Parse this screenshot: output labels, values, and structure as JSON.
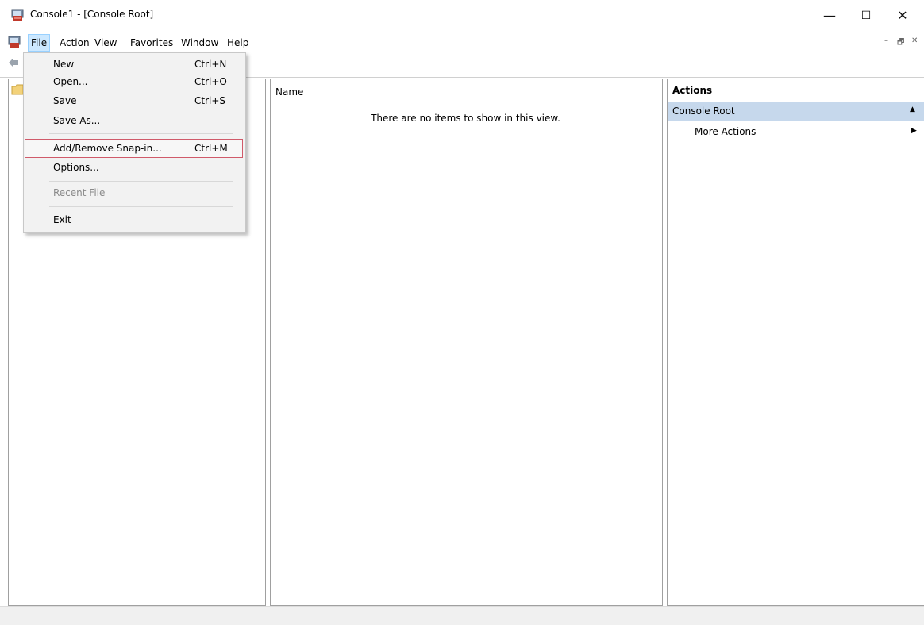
{
  "window": {
    "title": "Console1 - [Console Root]",
    "controls": {
      "minimize": "—",
      "maximize": "☐",
      "close": "✕"
    },
    "mdi_controls": {
      "minimize": "–",
      "restore": "🗗",
      "close": "✕"
    }
  },
  "menubar": {
    "items": [
      "File",
      "Action",
      "View",
      "Favorites",
      "Window",
      "Help"
    ]
  },
  "file_menu": {
    "items": [
      {
        "label": "New",
        "shortcut": "Ctrl+N"
      },
      {
        "label": "Open...",
        "shortcut": "Ctrl+O"
      },
      {
        "label": "Save",
        "shortcut": "Ctrl+S"
      },
      {
        "label": "Save As...",
        "shortcut": ""
      },
      {
        "label": "Add/Remove Snap-in...",
        "shortcut": "Ctrl+M"
      },
      {
        "label": "Options...",
        "shortcut": ""
      },
      {
        "label": "Recent File",
        "shortcut": ""
      },
      {
        "label": "Exit",
        "shortcut": ""
      }
    ]
  },
  "list_pane": {
    "column_name": "Name",
    "empty_message": "There are no items to show in this view."
  },
  "actions_pane": {
    "title": "Actions",
    "section": "Console Root",
    "more_actions": "More Actions"
  },
  "colors": {
    "accent_selection": "#c6d8ec",
    "menu_highlight_border": "#d05a6a"
  }
}
